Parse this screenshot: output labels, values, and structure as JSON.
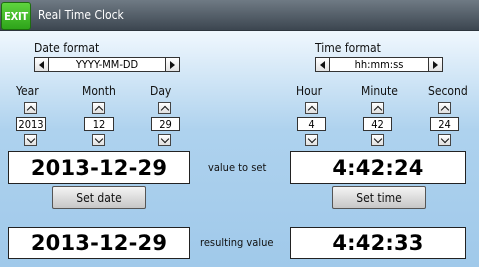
{
  "window": {
    "exit_label": "EXIT",
    "title": "Real Time Clock"
  },
  "date_format": {
    "label": "Date format",
    "value": "YYYY-MM-DD"
  },
  "time_format": {
    "label": "Time format",
    "value": "hh:mm:ss"
  },
  "date_fields": {
    "year": {
      "label": "Year",
      "value": "2013"
    },
    "month": {
      "label": "Month",
      "value": "12"
    },
    "day": {
      "label": "Day",
      "value": "29"
    }
  },
  "time_fields": {
    "hour": {
      "label": "Hour",
      "value": "4"
    },
    "minute": {
      "label": "Minute",
      "value": "42"
    },
    "second": {
      "label": "Second",
      "value": "24"
    }
  },
  "value_to_set": {
    "label": "value to set",
    "date": "2013-12-29",
    "time": "4:42:24"
  },
  "buttons": {
    "set_date": "Set date",
    "set_time": "Set time"
  },
  "resulting_value": {
    "label": "resulting value",
    "date": "2013-12-29",
    "time": "4:42:33"
  }
}
